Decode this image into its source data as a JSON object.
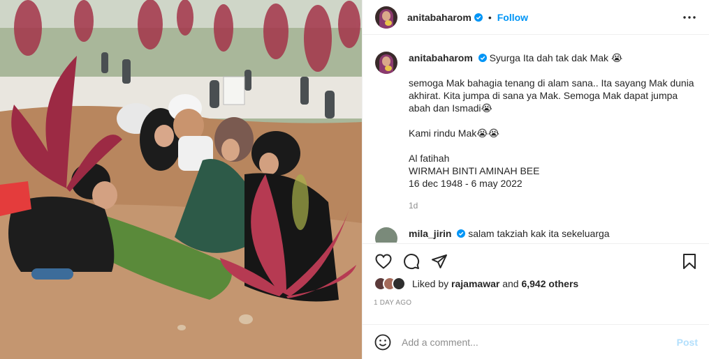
{
  "post": {
    "username": "anitabaharom",
    "follow_label": "Follow",
    "separator": "•"
  },
  "caption": {
    "username": "anitabaharom",
    "title": "Syurga Ita dah tak dak Mak 😭",
    "para1": "semoga Mak bahagia tenang di alam sana.. Ita sayang Mak dunia akhirat. Kita jumpa di sana ya Mak. Semoga Mak dapat jumpa abah dan Ismadi😭",
    "para2": "Kami rindu Mak😭😭",
    "line1": "Al fatihah",
    "line2": "WIRMAH BINTI AMINAH BEE",
    "line3": "16 dec 1948 - 6 may 2022",
    "time": "1d"
  },
  "comment2": {
    "username": "mila_jirin",
    "text": "salam takziah kak ita sekeluarga"
  },
  "likes": {
    "prefix": "Liked by",
    "user": "rajamawar",
    "and": "and",
    "count": "6,942 others"
  },
  "date": "1 DAY AGO",
  "add_comment": {
    "placeholder": "Add a comment...",
    "post_label": "Post"
  },
  "icons": [
    "heart-icon",
    "comment-icon",
    "share-icon",
    "save-icon",
    "emoji-icon",
    "more-icon",
    "verified-icon"
  ],
  "colors": {
    "link": "#0095f6",
    "verified": "#0095f6",
    "post_disabled": "#b2dffc",
    "muted": "#8e8e8e"
  }
}
